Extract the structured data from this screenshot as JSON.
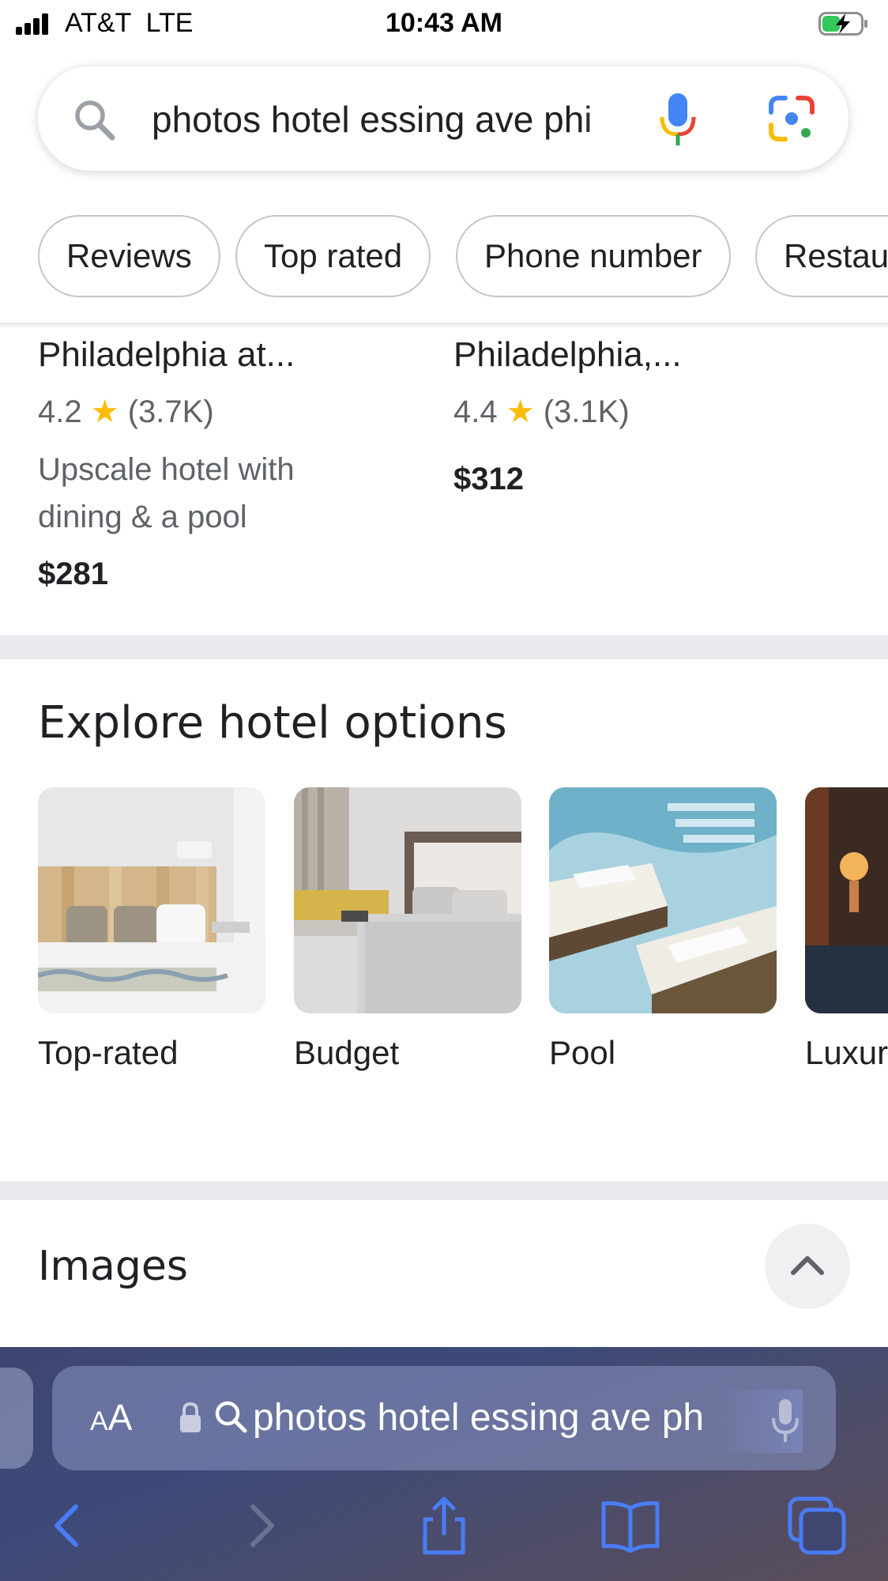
{
  "status_bar": {
    "carrier": "AT&T  LTE",
    "time": "10:43 AM"
  },
  "search": {
    "query": "photos hotel essing ave phi"
  },
  "chips": [
    "Reviews",
    "Top rated",
    "Phone number",
    "Restau"
  ],
  "hotels": [
    {
      "name": "Philadelphia at...",
      "rating": "4.2",
      "reviews": "(3.7K)",
      "description": "Upscale hotel with dining & a pool",
      "price": "$281"
    },
    {
      "name": "Philadelphia,...",
      "rating": "4.4",
      "reviews": "(3.1K)",
      "price": "$312"
    }
  ],
  "explore": {
    "title": "Explore hotel options",
    "options": [
      "Top-rated",
      "Budget",
      "Pool",
      "Luxur"
    ]
  },
  "images_section": {
    "title": "Images"
  },
  "safari": {
    "aa_small": "A",
    "aa_large": "A",
    "url_text": "photos hotel essing ave ph"
  },
  "colors": {
    "accent_blue": "#4a7cf6",
    "star": "#fbbc04",
    "divider": "#e8eaed"
  }
}
